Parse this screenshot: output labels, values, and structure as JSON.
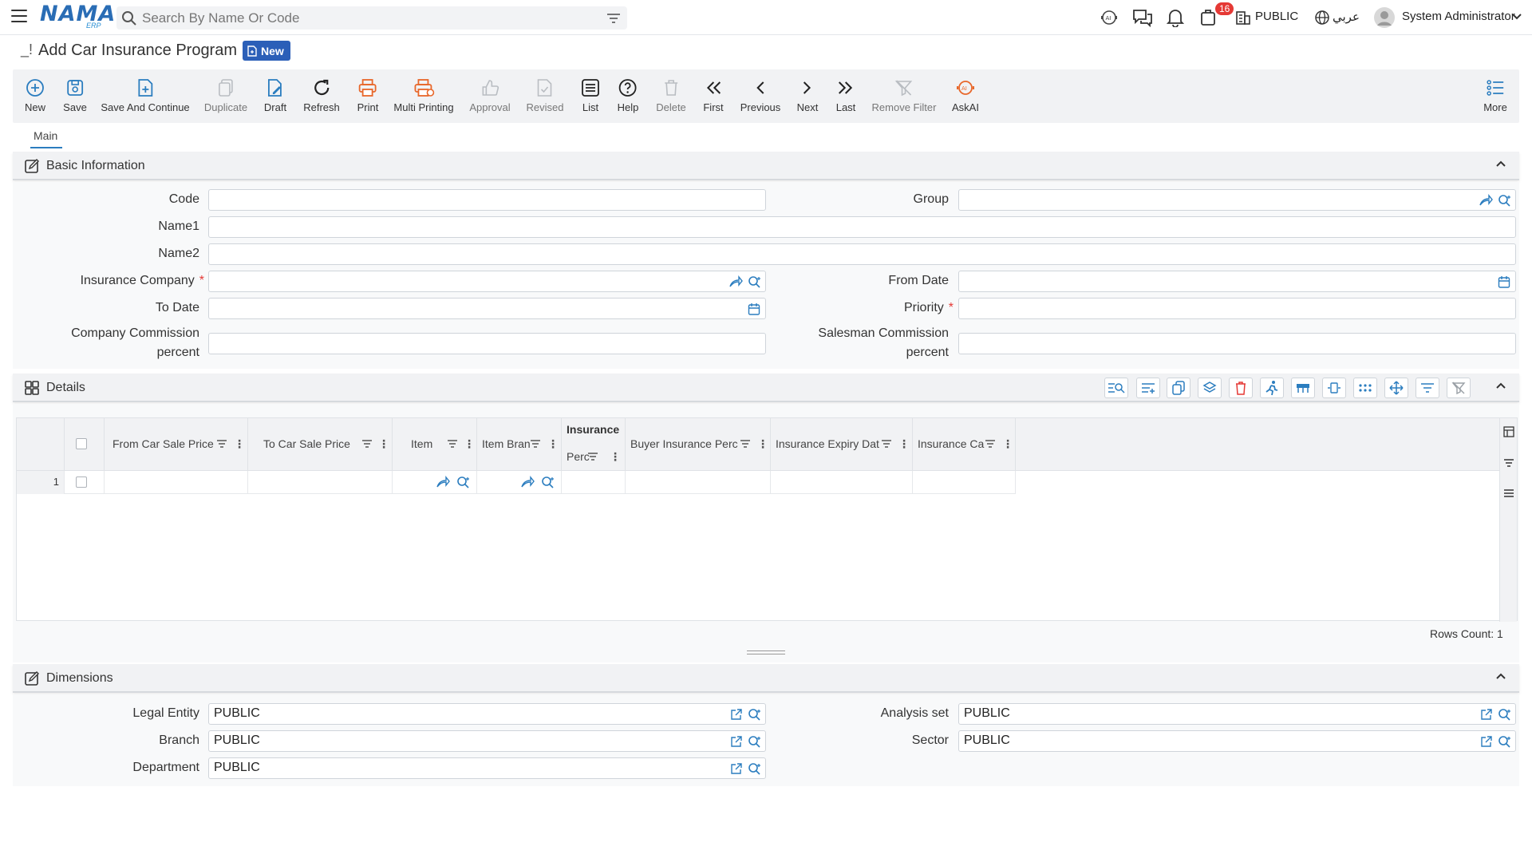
{
  "app": {
    "logo": "NAMA",
    "logo_sub": "ERP",
    "search_placeholder": "Search By Name Or Code",
    "notification_count": "16",
    "entity": "PUBLIC",
    "language": "عربي",
    "user": "System Administrator"
  },
  "page": {
    "title": "Add Car Insurance Program",
    "mode_badge": "New"
  },
  "toolbar": {
    "new": "New",
    "save": "Save",
    "save_continue": "Save And Continue",
    "duplicate": "Duplicate",
    "draft": "Draft",
    "refresh": "Refresh",
    "print": "Print",
    "multi_printing": "Multi Printing",
    "approval": "Approval",
    "revised": "Revised",
    "list": "List",
    "help": "Help",
    "delete": "Delete",
    "first": "First",
    "previous": "Previous",
    "next": "Next",
    "last": "Last",
    "remove_filter": "Remove Filter",
    "askai": "AskAI",
    "more": "More"
  },
  "tabs": {
    "main": "Main"
  },
  "basic": {
    "title": "Basic Information",
    "code_label": "Code",
    "group_label": "Group",
    "name1_label": "Name1",
    "name2_label": "Name2",
    "insurance_company_label": "Insurance Company",
    "from_date_label": "From Date",
    "to_date_label": "To Date",
    "priority_label": "Priority",
    "company_commission_label_1": "Company Commission",
    "company_commission_label_2": "percent",
    "salesman_commission_label_1": "Salesman Commission",
    "salesman_commission_label_2": "percent",
    "required_mark": "*"
  },
  "details": {
    "title": "Details",
    "columns": [
      "From Car Sale Price",
      "To Car Sale Price",
      "Item",
      "Item Bran",
      "Insurance",
      "Perc",
      "Buyer Insurance Perc",
      "Insurance Expiry Dat",
      "Insurance Ca"
    ],
    "row_number": "1",
    "rows_count": "Rows Count: 1"
  },
  "dimensions": {
    "title": "Dimensions",
    "legal_entity_label": "Legal Entity",
    "legal_entity_value": "PUBLIC",
    "analysis_set_label": "Analysis set",
    "analysis_set_value": "PUBLIC",
    "branch_label": "Branch",
    "branch_value": "PUBLIC",
    "sector_label": "Sector",
    "sector_value": "PUBLIC",
    "department_label": "Department",
    "department_value": "PUBLIC"
  },
  "colors": {
    "accent": "#2b7dbf",
    "badge_blue": "#2b5fb8",
    "print_orange": "#e8672a",
    "danger": "#e53935"
  }
}
